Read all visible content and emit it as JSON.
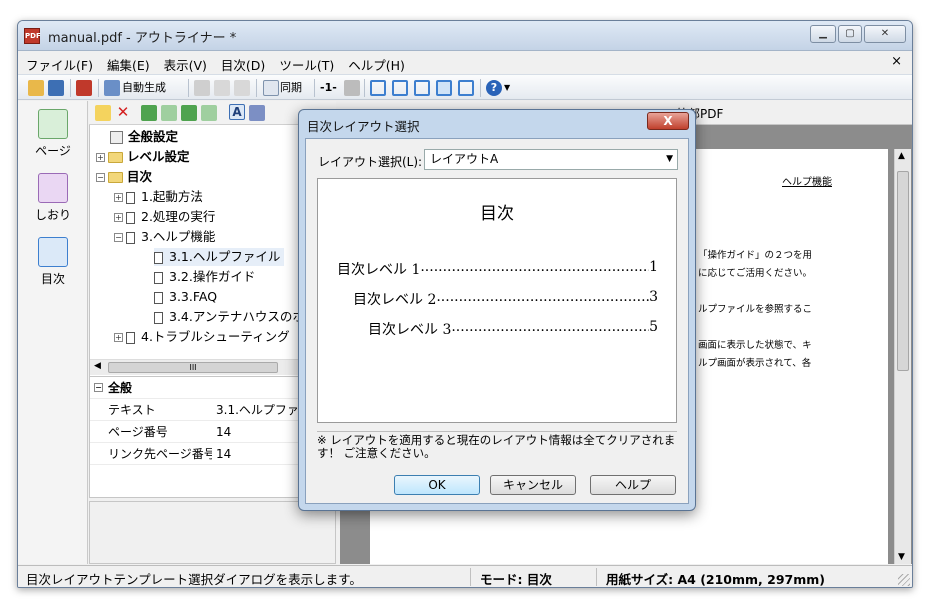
{
  "window": {
    "title": "manual.pdf - アウトライナー *"
  },
  "menu": [
    "ファイル(F)",
    "編集(E)",
    "表示(V)",
    "目次(D)",
    "ツール(T)",
    "ヘルプ(H)"
  ],
  "menu_close": "×",
  "toolbar": {
    "auto_generate": "自動生成",
    "sync": "同期",
    "level": "-1-",
    "help_glyph": "?"
  },
  "left_nav": [
    {
      "label": "ページ"
    },
    {
      "label": "しおり"
    },
    {
      "label": "目次"
    }
  ],
  "tree": {
    "general": "全般設定",
    "level": "レベル設定",
    "toc": "目次",
    "items": [
      "1.起動方法",
      "2.処理の実行",
      "3.ヘルプ機能",
      "3.1.ヘルプファイル",
      "3.2.操作ガイド",
      "3.3.FAQ",
      "3.4.アンテナハウスのホ",
      "4.トラブルシューティング"
    ],
    "scroll_glyph": "III"
  },
  "properties": {
    "section": "全般",
    "rows": [
      {
        "label": "テキスト",
        "value": "3.1.ヘルプファ"
      },
      {
        "label": "ページ番号",
        "value": "14"
      },
      {
        "label": "リンク先ページ番号",
        "value": "14"
      }
    ]
  },
  "viewer": {
    "toolbar_label": "外部PDF",
    "page_header": "ヘルプ機能",
    "page_lines": [
      "「操作ガイド」の２つを用",
      "に応じてご活用ください。",
      "",
      "ルプファイルを参照するこ",
      "",
      "画面に表示した状態で、キ",
      "ルプ画面が表示されて、各"
    ]
  },
  "status": {
    "message": "目次レイアウトテンプレート選択ダイアログを表示します。",
    "mode": "モード: 目次",
    "paper": "用紙サイズ: A4 (210mm, 297mm)"
  },
  "dialog": {
    "title": "目次レイアウト選択",
    "close": "X",
    "select_label": "レイアウト選択(L):",
    "selected": "レイアウトA",
    "preview": {
      "title": "目次",
      "lines": [
        {
          "text": "目次レベル 1",
          "page": "1"
        },
        {
          "text": "目次レベル 2",
          "page": "3"
        },
        {
          "text": "目次レベル 3",
          "page": "5"
        }
      ]
    },
    "note": "※ レイアウトを適用すると現在のレイアウト情報は全てクリアされます！ ご注意ください。",
    "buttons": {
      "ok": "OK",
      "cancel": "キャンセル",
      "help": "ヘルプ"
    }
  },
  "colors": {
    "accent": "#3c7fb1",
    "dialog_frame": "#c4d7ec",
    "close_red": "#c0402c"
  }
}
